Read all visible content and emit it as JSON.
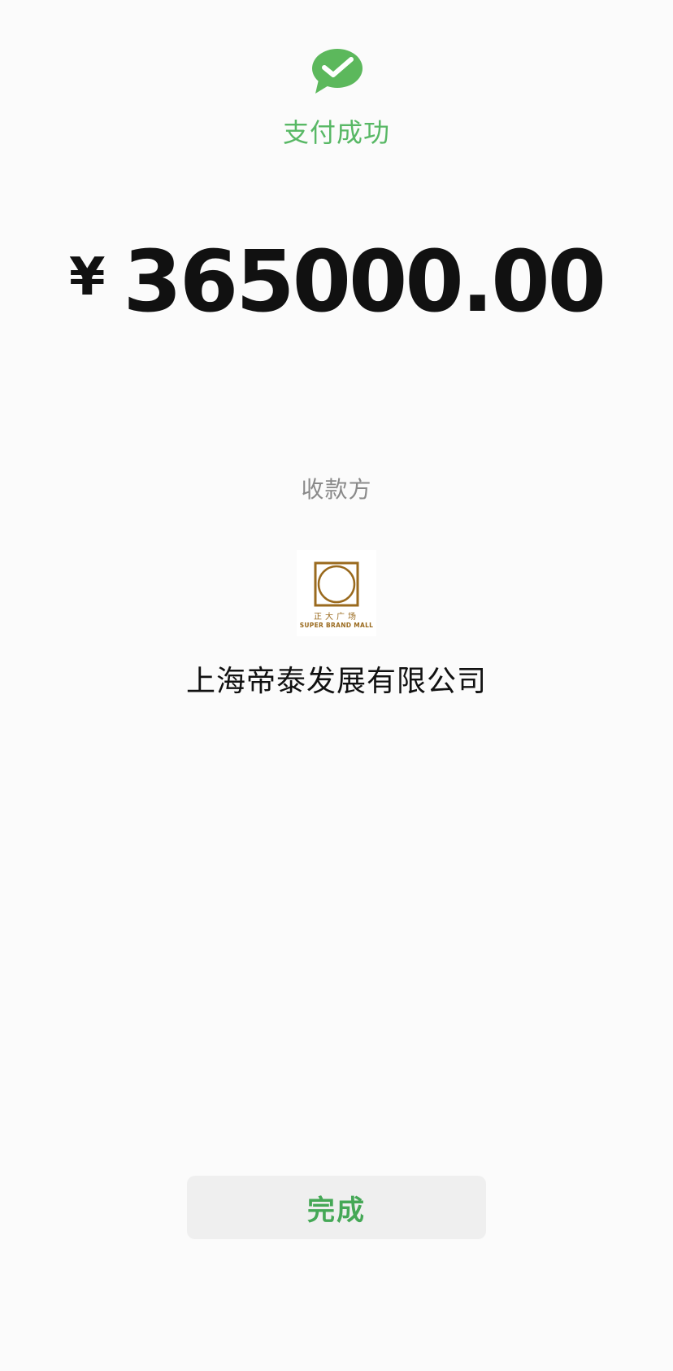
{
  "status": {
    "icon": "wechat-pay-check-icon",
    "text": "支付成功",
    "color": "#58b865"
  },
  "amount": {
    "currency": "¥",
    "value": "365000.00"
  },
  "payee": {
    "label": "收款方",
    "logo": {
      "icon": "super-brand-mall-logo",
      "cn_text": "正大广场",
      "en_text": "SUPER BRAND MALL",
      "color": "#9a6a1e"
    },
    "name": "上海帝泰发展有限公司"
  },
  "actions": {
    "done_label": "完成",
    "done_color": "#45a856"
  }
}
